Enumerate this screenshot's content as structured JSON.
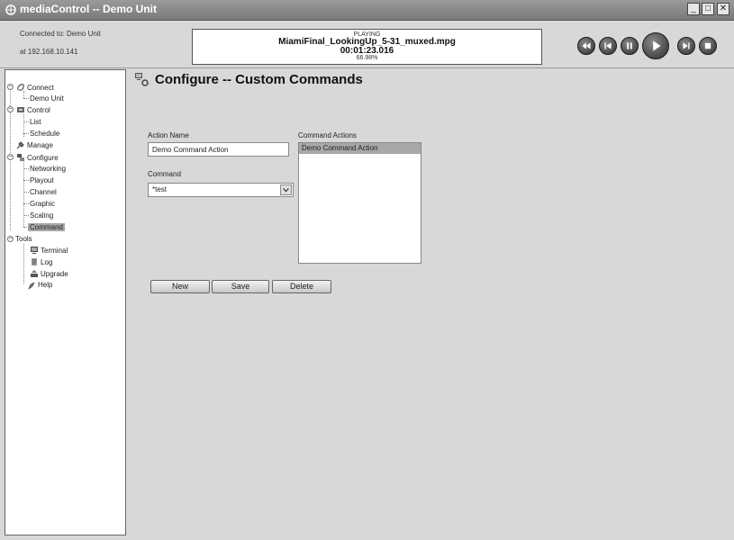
{
  "window": {
    "title": "mediaControl -- Demo Unit"
  },
  "connection": {
    "line1": "Connected to: Demo Unit",
    "line2": "at 192.168.10.141"
  },
  "now_playing": {
    "status": "PLAYING",
    "file": "MiamiFinal_LookingUp_5-31_muxed.mpg",
    "time": "00:01:23.016",
    "percent": "66.98%"
  },
  "transport": [
    "rewind-icon",
    "previous-icon",
    "pause-icon",
    "play-icon",
    "next-icon",
    "stop-icon"
  ],
  "sidebar": {
    "connect": "Connect",
    "demo_unit": "Demo Unit",
    "control": "Control",
    "list": "List",
    "schedule": "Schedule",
    "manage": "Manage",
    "configure": "Configure",
    "networking": "Networking",
    "playout": "Playout",
    "channel": "Channel",
    "graphic": "Graphic",
    "scaling": "Scaling",
    "command": "Command",
    "tools": "Tools",
    "terminal": "Terminal",
    "log": "Log",
    "upgrade": "Upgrade",
    "help": "Help"
  },
  "page": {
    "title": "Configure -- Custom Commands",
    "action_name_label": "Action Name",
    "action_name_value": "Demo Command Action",
    "command_label": "Command",
    "command_value": "*test",
    "command_actions_label": "Command Actions",
    "command_actions": [
      "Demo Command Action"
    ],
    "buttons": {
      "new": "New",
      "save": "Save",
      "delete": "Delete"
    }
  }
}
